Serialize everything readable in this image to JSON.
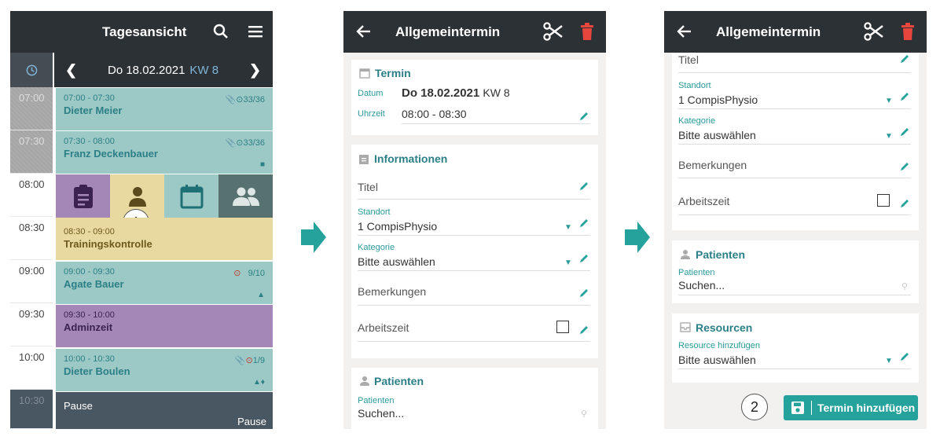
{
  "day_view": {
    "title": "Tagesansicht",
    "date": "Do 18.02.2021",
    "kw": "KW 8",
    "time_slots": [
      "07:00",
      "07:30",
      "08:00",
      "08:30",
      "09:00",
      "09:30",
      "10:00",
      "10:30"
    ],
    "appointments": [
      {
        "time": "07:00 - 07:30",
        "name": "Dieter Meier",
        "meta": "33/36"
      },
      {
        "time": "07:30 - 08:00",
        "name": "Franz Deckenbauer",
        "meta": "33/36"
      },
      {
        "time": "08:30 - 09:00",
        "name": "Trainingskontrolle",
        "meta": ""
      },
      {
        "time": "09:00 - 09:30",
        "name": "Agate Bauer",
        "meta": "9/10"
      },
      {
        "time": "09:30 - 10:00",
        "name": "Adminzeit",
        "meta": ""
      },
      {
        "time": "10:00 - 10:30",
        "name": "Dieter Boulen",
        "meta": "1/9"
      }
    ],
    "pause_label": "Pause",
    "pause_label_right": "Pause",
    "step_badge": "1"
  },
  "form": {
    "title": "Allgemeintermin",
    "termin_heading": "Termin",
    "datum_label": "Datum",
    "datum_value": "Do 18.02.2021",
    "datum_kw": "KW 8",
    "uhrzeit_label": "Uhrzeit",
    "uhrzeit_value": "08:00 - 08:30",
    "informationen_heading": "Informationen",
    "titel_label": "Titel",
    "standort_label": "Standort",
    "standort_value": "1 CompisPhysio",
    "kategorie_label": "Kategorie",
    "kategorie_value": "Bitte auswählen",
    "bemerkungen_label": "Bemerkungen",
    "arbeitszeit_label": "Arbeitszeit",
    "patienten_heading": "Patienten",
    "patienten_label": "Patienten",
    "patienten_placeholder": "Suchen...",
    "resourcen_heading": "Resourcen",
    "resource_label": "Resource hinzufügen",
    "resource_value": "Bitte auswählen",
    "save_label": "Termin hinzufügen",
    "step_badge": "2",
    "partial_titel": "Titel"
  },
  "colors": {
    "header": "#2c3136",
    "accent": "#26a29c",
    "delete": "#e8453c"
  }
}
